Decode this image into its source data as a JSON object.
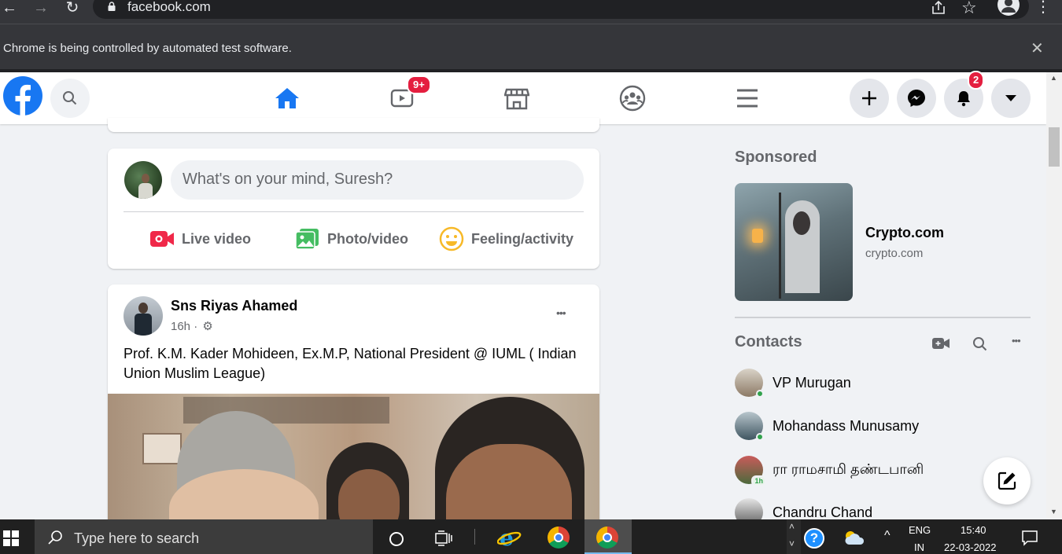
{
  "browser": {
    "url": "facebook.com",
    "infobar_text": "Chrome is being controlled by automated test software.",
    "infobar_close": "✕"
  },
  "header": {
    "watch_badge": "9+",
    "notifications_badge": "2"
  },
  "composer": {
    "placeholder": "What's on your mind, Suresh?",
    "actions": [
      "Live video",
      "Photo/video",
      "Feeling/activity"
    ]
  },
  "post": {
    "author": "Sns Riyas Ahamed",
    "time": "16h ·",
    "more": "•••",
    "text": "Prof. K.M. Kader Mohideen, Ex.M.P, National President @ IUML ( Indian Union Muslim League)"
  },
  "sidebar": {
    "sponsored_title": "Sponsored",
    "ad_name": "Crypto.com",
    "ad_domain": "crypto.com",
    "contacts_title": "Contacts",
    "contacts": [
      {
        "name": "VP Murugan",
        "status": "online"
      },
      {
        "name": "Mohandass Munusamy",
        "status": "online"
      },
      {
        "name": "ரா ராமசாமி தண்டபானி",
        "status": "1h"
      },
      {
        "name": "Chandru Chand",
        "status": ""
      }
    ]
  },
  "taskbar": {
    "search_placeholder": "Type here to search",
    "lang_top": "ENG",
    "lang_bottom": "IN",
    "time": "15:40",
    "date": "22-03-2022"
  },
  "colors": {
    "fb_blue": "#1877f2",
    "badge_red": "#e41e3f",
    "online_green": "#31a24c"
  }
}
